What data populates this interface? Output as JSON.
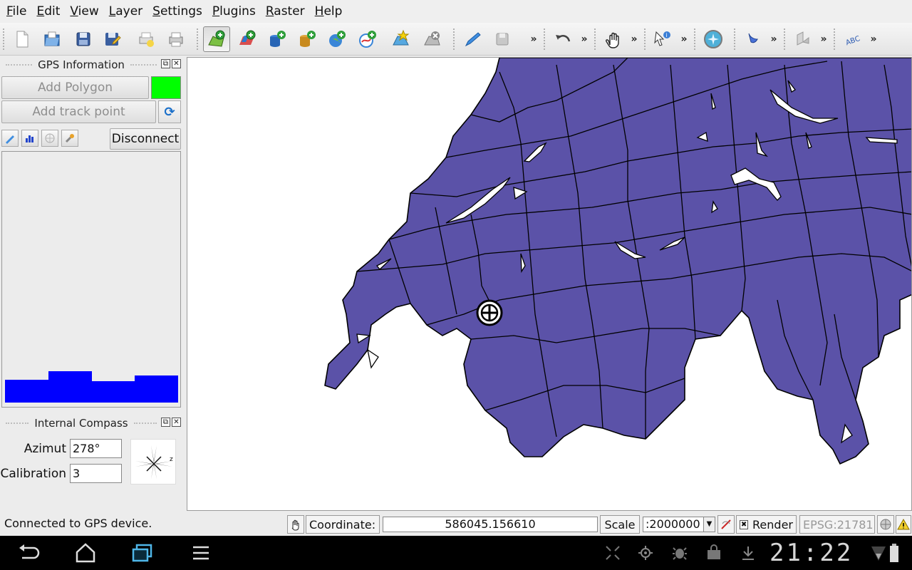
{
  "menu": [
    "File",
    "Edit",
    "View",
    "Layer",
    "Settings",
    "Plugins",
    "Raster",
    "Help"
  ],
  "toolbar": {
    "buttons": [
      "new-project-icon",
      "open-project-icon",
      "save-project-icon",
      "save-as-icon",
      "print-composer-icon",
      "print-icon",
      "add-vector-layer-icon",
      "add-raster-layer-icon",
      "add-postgis-layer-icon",
      "add-spatialite-layer-icon",
      "add-wms-layer-icon",
      "add-wfs-layer-icon",
      "new-shapefile-icon",
      "remove-layer-icon",
      "toggle-editing-icon",
      "save-edits-icon",
      "undo-icon",
      "pan-icon",
      "identify-icon",
      "compass-icon",
      "select-icon",
      "digitize-icon",
      "label-icon"
    ],
    "more": "»"
  },
  "gps": {
    "title": "GPS Information",
    "add_polygon": "Add Polygon",
    "add_track_point": "Add track point",
    "disconnect": "Disconnect",
    "polygon_color": "#00ff00",
    "signal_bars": [
      0.7,
      0.95,
      0.65,
      0.82
    ]
  },
  "compass": {
    "title": "Internal Compass",
    "azimut_label": "Azimut",
    "azimut_value": "278°",
    "calibration_label": "Calibration",
    "calibration_value": "3",
    "needle_letter": "z"
  },
  "map": {
    "fill_color": "#5b52a8",
    "outline_color": "#000000"
  },
  "statusbar": {
    "message": "Connected to GPS device.",
    "coordinate_label": "Coordinate:",
    "coordinate_value": "586045.156610",
    "scale_label": "Scale",
    "scale_value": ":2000000",
    "render_label": "Render",
    "crs": "EPSG:21781"
  },
  "android": {
    "clock": "21:22"
  }
}
